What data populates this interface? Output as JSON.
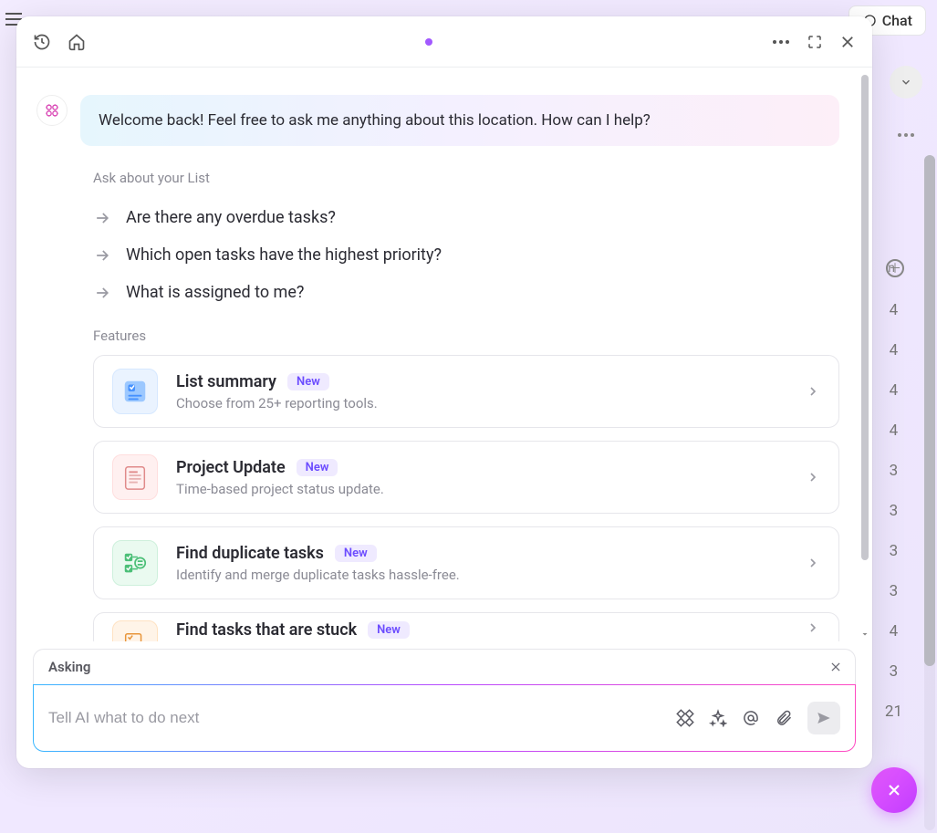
{
  "header": {
    "chat_button": "Chat"
  },
  "modal": {
    "greeting": "Welcome back! Feel free to ask me anything about this location. How can I help?",
    "section_label": "Ask about your List",
    "suggestions": [
      "Are there any overdue tasks?",
      "Which open tasks have the highest priority?",
      "What is assigned to me?"
    ],
    "features_label": "Features",
    "features": [
      {
        "title": "List summary",
        "subtitle": "Choose from 25+ reporting tools.",
        "badge": "New",
        "tone": "blue"
      },
      {
        "title": "Project Update",
        "subtitle": "Time-based project status update.",
        "badge": "New",
        "tone": "pink"
      },
      {
        "title": "Find duplicate tasks",
        "subtitle": "Identify and merge duplicate tasks hassle-free.",
        "badge": "New",
        "tone": "green"
      },
      {
        "title": "Find tasks that are stuck",
        "subtitle": "",
        "badge": "New",
        "tone": "orange"
      }
    ],
    "input": {
      "context_label": "Asking",
      "placeholder": "Tell AI what to do next"
    }
  },
  "background": {
    "time_col_header": "n",
    "numbers": [
      "4",
      "4",
      "4",
      "4",
      "3",
      "3",
      "3",
      "3",
      "4",
      "3",
      "21"
    ]
  }
}
